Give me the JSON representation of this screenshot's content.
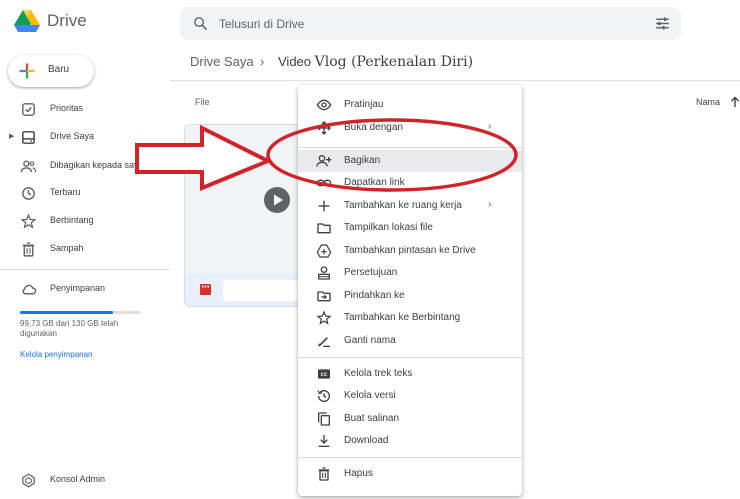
{
  "app": {
    "name": "Drive"
  },
  "search": {
    "placeholder": "Telusuri di Drive"
  },
  "sidebar": {
    "new_label": "Baru",
    "items": [
      {
        "label": "Prioritas",
        "icon": "check-circle-icon"
      },
      {
        "label": "Drive Saya",
        "icon": "my-drive-icon"
      },
      {
        "label": "Dibagikan kepada saya",
        "icon": "people-icon"
      },
      {
        "label": "Terbaru",
        "icon": "clock-icon"
      },
      {
        "label": "Berbintang",
        "icon": "star-icon"
      },
      {
        "label": "Sampah",
        "icon": "trash-icon"
      }
    ],
    "storage_label": "Penyimpanan",
    "storage_text": "99,73 GB dari 130 GB telah digunakan",
    "storage_fraction": 0.767,
    "manage_link": "Kelola penyimpanan",
    "admin_label": "Konsol Admin"
  },
  "breadcrumb": {
    "root": "Drive Saya",
    "separator": "›",
    "current_prefix": "Video",
    "current_suffix": "Vlog (Perkenalan Diri)"
  },
  "list": {
    "file_header": "File",
    "name_header": "Nama"
  },
  "context_menu": {
    "items": [
      {
        "label": "Pratinjau",
        "icon": "eye-icon"
      },
      {
        "label": "Buka dengan",
        "icon": "open-with-icon",
        "has_submenu": true
      },
      {
        "label": "Bagikan",
        "icon": "person-add-icon",
        "highlighted": true
      },
      {
        "label": "Dapatkan link",
        "icon": "link-icon"
      },
      {
        "label": "Tambahkan ke ruang kerja",
        "icon": "plus-icon",
        "has_submenu": true
      },
      {
        "label": "Tampilkan lokasi file",
        "icon": "folder-icon"
      },
      {
        "label": "Tambahkan pintasan ke Drive",
        "icon": "add-shortcut-icon"
      },
      {
        "label": "Persetujuan",
        "icon": "approval-icon"
      },
      {
        "label": "Pindahkan ke",
        "icon": "move-to-icon"
      },
      {
        "label": "Tambahkan ke Berbintang",
        "icon": "star-icon"
      },
      {
        "label": "Ganti nama",
        "icon": "rename-icon"
      },
      {
        "label": "Kelola trek teks",
        "icon": "closed-caption-icon"
      },
      {
        "label": "Kelola versi",
        "icon": "history-icon"
      },
      {
        "label": "Buat salinan",
        "icon": "copy-icon"
      },
      {
        "label": "Download",
        "icon": "download-icon"
      },
      {
        "label": "Hapus",
        "icon": "trash-icon"
      }
    ]
  },
  "colors": {
    "annotation": "#d2232a",
    "accent": "#1a73e8",
    "highlight": "#e8eaed"
  }
}
